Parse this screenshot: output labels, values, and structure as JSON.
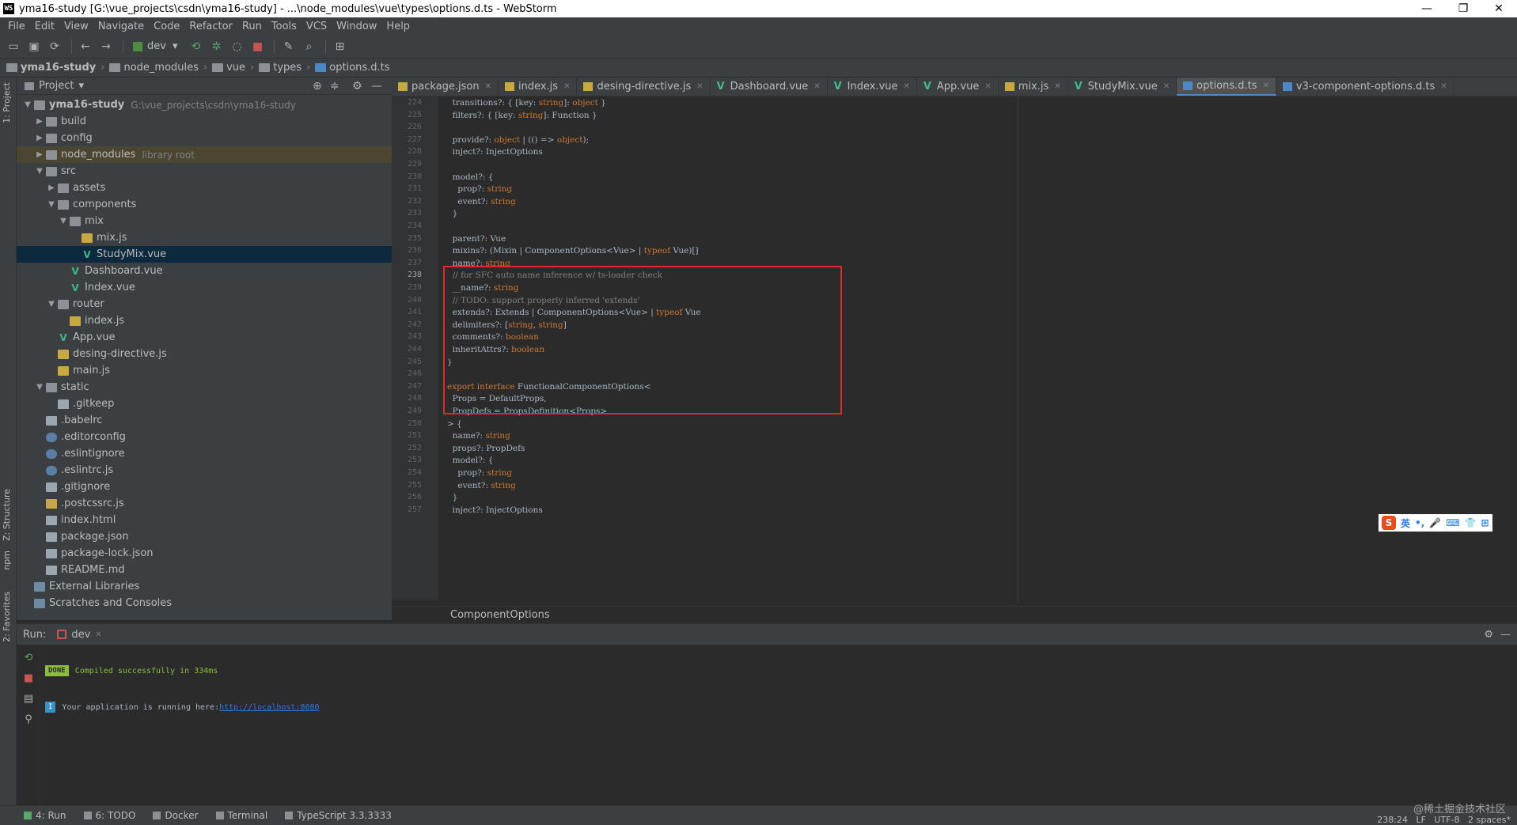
{
  "window": {
    "title": "yma16-study [G:\\vue_projects\\csdn\\yma16-study] - ...\\node_modules\\vue\\types\\options.d.ts - WebStorm",
    "app_icon": "WS"
  },
  "menu": [
    "File",
    "Edit",
    "View",
    "Navigate",
    "Code",
    "Refactor",
    "Run",
    "Tools",
    "VCS",
    "Window",
    "Help"
  ],
  "toolbar": {
    "run_config": "dev"
  },
  "breadcrumbs": [
    "yma16-study",
    "node_modules",
    "vue",
    "types",
    "options.d.ts"
  ],
  "project": {
    "header": "Project",
    "tree": [
      {
        "label": "yma16-study",
        "sub": "G:\\vue_projects\\csdn\\yma16-study",
        "depth": 0,
        "arrow": "▼",
        "icon": "dir",
        "bold": true
      },
      {
        "label": "build",
        "depth": 1,
        "arrow": "▶",
        "icon": "dir"
      },
      {
        "label": "config",
        "depth": 1,
        "arrow": "▶",
        "icon": "dir"
      },
      {
        "label": "node_modules",
        "sub": "library root",
        "depth": 1,
        "arrow": "▶",
        "icon": "dir",
        "hl": true
      },
      {
        "label": "src",
        "depth": 1,
        "arrow": "▼",
        "icon": "dir"
      },
      {
        "label": "assets",
        "depth": 2,
        "arrow": "▶",
        "icon": "dir"
      },
      {
        "label": "components",
        "depth": 2,
        "arrow": "▼",
        "icon": "dir"
      },
      {
        "label": "mix",
        "depth": 3,
        "arrow": "▼",
        "icon": "dir"
      },
      {
        "label": "mix.js",
        "depth": 4,
        "arrow": "",
        "icon": "js"
      },
      {
        "label": "StudyMix.vue",
        "depth": 4,
        "arrow": "",
        "icon": "vue",
        "sel": true
      },
      {
        "label": "Dashboard.vue",
        "depth": 3,
        "arrow": "",
        "icon": "vue"
      },
      {
        "label": "Index.vue",
        "depth": 3,
        "arrow": "",
        "icon": "vue"
      },
      {
        "label": "router",
        "depth": 2,
        "arrow": "▼",
        "icon": "dir"
      },
      {
        "label": "index.js",
        "depth": 3,
        "arrow": "",
        "icon": "js"
      },
      {
        "label": "App.vue",
        "depth": 2,
        "arrow": "",
        "icon": "vue"
      },
      {
        "label": "desing-directive.js",
        "depth": 2,
        "arrow": "",
        "icon": "js"
      },
      {
        "label": "main.js",
        "depth": 2,
        "arrow": "",
        "icon": "js"
      },
      {
        "label": "static",
        "depth": 1,
        "arrow": "▼",
        "icon": "dir"
      },
      {
        "label": ".gitkeep",
        "depth": 2,
        "arrow": "",
        "icon": "file"
      },
      {
        "label": ".babelrc",
        "depth": 1,
        "arrow": "",
        "icon": "file"
      },
      {
        "label": ".editorconfig",
        "depth": 1,
        "arrow": "",
        "icon": "cfg"
      },
      {
        "label": ".eslintignore",
        "depth": 1,
        "arrow": "",
        "icon": "cfg"
      },
      {
        "label": ".eslintrc.js",
        "depth": 1,
        "arrow": "",
        "icon": "cfg"
      },
      {
        "label": ".gitignore",
        "depth": 1,
        "arrow": "",
        "icon": "file"
      },
      {
        "label": ".postcssrc.js",
        "depth": 1,
        "arrow": "",
        "icon": "js"
      },
      {
        "label": "index.html",
        "depth": 1,
        "arrow": "",
        "icon": "file"
      },
      {
        "label": "package.json",
        "depth": 1,
        "arrow": "",
        "icon": "file"
      },
      {
        "label": "package-lock.json",
        "depth": 1,
        "arrow": "",
        "icon": "file"
      },
      {
        "label": "README.md",
        "depth": 1,
        "arrow": "",
        "icon": "file"
      },
      {
        "label": "External Libraries",
        "depth": 0,
        "arrow": "",
        "icon": "lib"
      },
      {
        "label": "Scratches and Consoles",
        "depth": 0,
        "arrow": "",
        "icon": "lib"
      }
    ]
  },
  "tabs": [
    {
      "label": "package.json",
      "icon": "js"
    },
    {
      "label": "index.js",
      "icon": "js"
    },
    {
      "label": "desing-directive.js",
      "icon": "js"
    },
    {
      "label": "Dashboard.vue",
      "icon": "vue"
    },
    {
      "label": "Index.vue",
      "icon": "vue"
    },
    {
      "label": "App.vue",
      "icon": "vue"
    },
    {
      "label": "mix.js",
      "icon": "js"
    },
    {
      "label": "StudyMix.vue",
      "icon": "vue"
    },
    {
      "label": "options.d.ts",
      "icon": "ts",
      "active": true
    },
    {
      "label": "v3-component-options.d.ts",
      "icon": "ts"
    }
  ],
  "code": [
    {
      "n": "224",
      "t": "  transitions?: { [key: string]: object }"
    },
    {
      "n": "225",
      "t": "  filters?: { [key: string]: Function }"
    },
    {
      "n": "226",
      "t": ""
    },
    {
      "n": "227",
      "t": "  provide?: object | (() => object);"
    },
    {
      "n": "228",
      "t": "  inject?: InjectOptions"
    },
    {
      "n": "229",
      "t": ""
    },
    {
      "n": "230",
      "t": "  model?: {"
    },
    {
      "n": "231",
      "t": "    prop?: string"
    },
    {
      "n": "232",
      "t": "    event?: string"
    },
    {
      "n": "233",
      "t": "  }"
    },
    {
      "n": "234",
      "t": ""
    },
    {
      "n": "235",
      "t": "  parent?: Vue"
    },
    {
      "n": "236",
      "t": "  mixins?: (Mixin | ComponentOptions<Vue> | typeof Vue)[]"
    },
    {
      "n": "237",
      "t": "  name?: string"
    },
    {
      "n": "238",
      "t": "  // for SFC auto name inference w/ ts-loader check"
    },
    {
      "n": "239",
      "t": "  __name?: string"
    },
    {
      "n": "240",
      "t": "  // TODO: support properly inferred 'extends'"
    },
    {
      "n": "241",
      "t": "  extends?: Extends | ComponentOptions<Vue> | typeof Vue"
    },
    {
      "n": "242",
      "t": "  delimiters?: [string, string]"
    },
    {
      "n": "243",
      "t": "  comments?: boolean"
    },
    {
      "n": "244",
      "t": "  inheritAttrs?: boolean"
    },
    {
      "n": "245",
      "t": "}"
    },
    {
      "n": "246",
      "t": ""
    },
    {
      "n": "247",
      "t": "export interface FunctionalComponentOptions<"
    },
    {
      "n": "248",
      "t": "  Props = DefaultProps,"
    },
    {
      "n": "249",
      "t": "  PropDefs = PropsDefinition<Props>"
    },
    {
      "n": "250",
      "t": "> {"
    },
    {
      "n": "251",
      "t": "  name?: string"
    },
    {
      "n": "252",
      "t": "  props?: PropDefs"
    },
    {
      "n": "253",
      "t": "  model?: {"
    },
    {
      "n": "254",
      "t": "    prop?: string"
    },
    {
      "n": "255",
      "t": "    event?: string"
    },
    {
      "n": "256",
      "t": "  }"
    },
    {
      "n": "257",
      "t": "  inject?: InjectOptions"
    }
  ],
  "code_breadcrumb": "ComponentOptions",
  "run": {
    "label": "Run:",
    "config": "dev",
    "done_badge": "DONE",
    "compiled": "Compiled successfully in 334ms",
    "info_badge": "I",
    "running": "Your application is running here: ",
    "url": "http://localhost:8080"
  },
  "bottom_tabs": [
    "4: Run",
    "6: TODO",
    "Docker",
    "Terminal",
    "TypeScript 3.3.3333"
  ],
  "status": {
    "position": "238:24",
    "line_sep": "LF",
    "encoding": "UTF-8",
    "indent": "2 spaces*"
  },
  "left_strip": {
    "project": "1: Project",
    "structure": "Z: Structure",
    "npm": "npm",
    "favorites": "2: Favorites"
  },
  "ime": {
    "lang": "英"
  },
  "watermark": "@稀土掘金技术社区"
}
